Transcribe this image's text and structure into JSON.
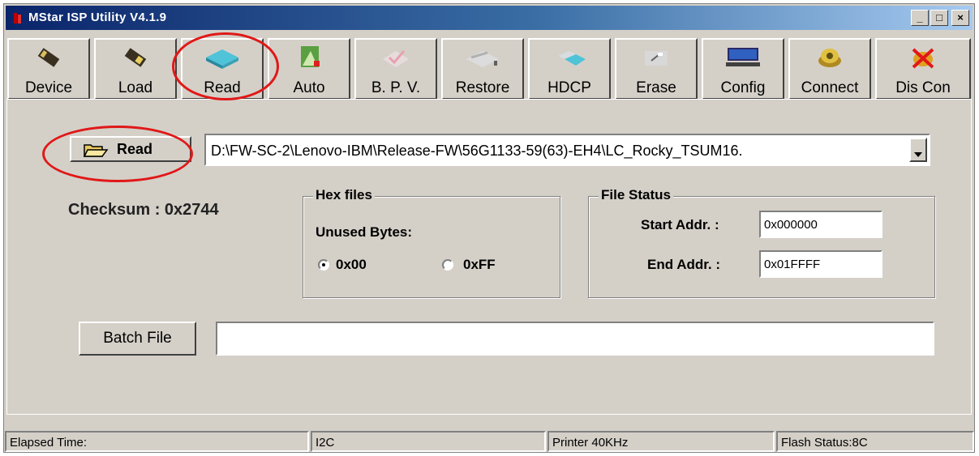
{
  "window": {
    "title": "MStar ISP Utility V4.1.9",
    "controls": {
      "minimize": "_",
      "maximize": "□",
      "close": "×"
    }
  },
  "toolbar": {
    "buttons": [
      {
        "label": "Device",
        "icon": "device-chip-icon",
        "enabled": true
      },
      {
        "label": "Load",
        "icon": "load-chip-icon",
        "enabled": true
      },
      {
        "label": "Read",
        "icon": "read-icon",
        "enabled": true
      },
      {
        "label": "Auto",
        "icon": "auto-icon",
        "enabled": true
      },
      {
        "label": "B. P. V.",
        "icon": "bpv-icon",
        "enabled": false
      },
      {
        "label": "Restore",
        "icon": "restore-icon",
        "enabled": true
      },
      {
        "label": "HDCP",
        "icon": "hdcp-icon",
        "enabled": true
      },
      {
        "label": "Erase",
        "icon": "erase-icon",
        "enabled": true
      },
      {
        "label": "Config",
        "icon": "config-monitor-icon",
        "enabled": true
      },
      {
        "label": "Connect",
        "icon": "connect-icon",
        "enabled": true
      },
      {
        "label": "Dis Con",
        "icon": "disconnect-icon",
        "enabled": true
      }
    ]
  },
  "main": {
    "read_button": {
      "label": "Read",
      "icon": "folder-open-icon"
    },
    "file_path": "D:\\FW-SC-2\\Lenovo-IBM\\Release-FW\\56G1133-59(63)-EH4\\LC_Rocky_TSUM16.",
    "checksum": "Checksum : 0x2744",
    "hex_files": {
      "title": "Hex files",
      "unused_bytes_label": "Unused Bytes:",
      "option_00": "0x00",
      "option_ff": "0xFF",
      "selected": "0x00"
    },
    "file_status": {
      "title": "File Status",
      "start_label": "Start Addr. :",
      "start_value": "0x000000",
      "end_label": "End Addr. :",
      "end_value": "0x01FFFF"
    },
    "batch_file_label": "Batch File",
    "batch_file_value": ""
  },
  "status_bar": {
    "elapsed": "Elapsed Time:",
    "interface": "I2C",
    "printer": "Printer  40KHz",
    "flash_status": "Flash Status:8C"
  },
  "colors": {
    "highlight_circle": "#e01818",
    "titlebar_start": "#0a246a",
    "face": "#d4d0c8"
  }
}
